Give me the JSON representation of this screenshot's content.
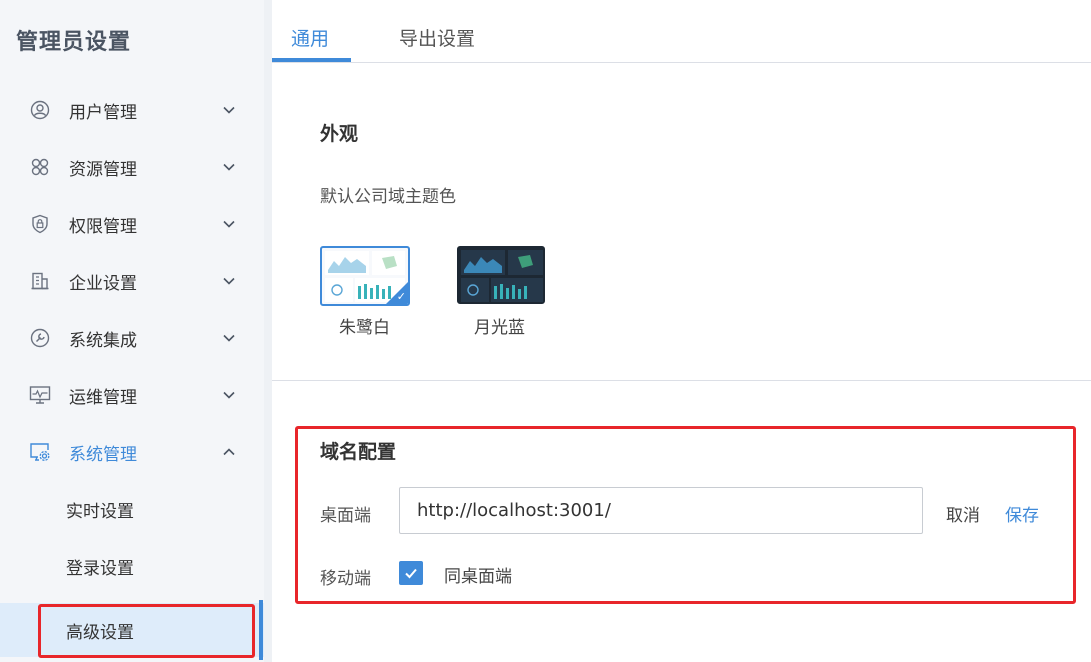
{
  "sidebar": {
    "title": "管理员设置",
    "items": [
      {
        "label": "用户管理",
        "icon": "user-icon"
      },
      {
        "label": "资源管理",
        "icon": "resource-icon"
      },
      {
        "label": "权限管理",
        "icon": "shield-lock-icon"
      },
      {
        "label": "企业设置",
        "icon": "building-icon"
      },
      {
        "label": "系统集成",
        "icon": "wrench-icon"
      },
      {
        "label": "运维管理",
        "icon": "monitor-icon"
      },
      {
        "label": "系统管理",
        "icon": "gear-screen-icon"
      }
    ],
    "sub_items": [
      {
        "label": "实时设置"
      },
      {
        "label": "登录设置"
      },
      {
        "label": "高级设置"
      }
    ],
    "accent": "#3f8ad9"
  },
  "tabs": [
    {
      "label": "通用",
      "active": true
    },
    {
      "label": "导出设置",
      "active": false
    }
  ],
  "appearance": {
    "title": "外观",
    "subtitle": "默认公司域主题色",
    "themes": [
      {
        "label": "朱鹭白",
        "selected": true
      },
      {
        "label": "月光蓝",
        "selected": false
      }
    ]
  },
  "domain": {
    "title": "域名配置",
    "desktop_label": "桌面端",
    "desktop_value": "http://localhost:3001/",
    "cancel_label": "取消",
    "save_label": "保存",
    "mobile_label": "移动端",
    "same_as_desktop_label": "同桌面端",
    "same_as_desktop_checked": true
  }
}
